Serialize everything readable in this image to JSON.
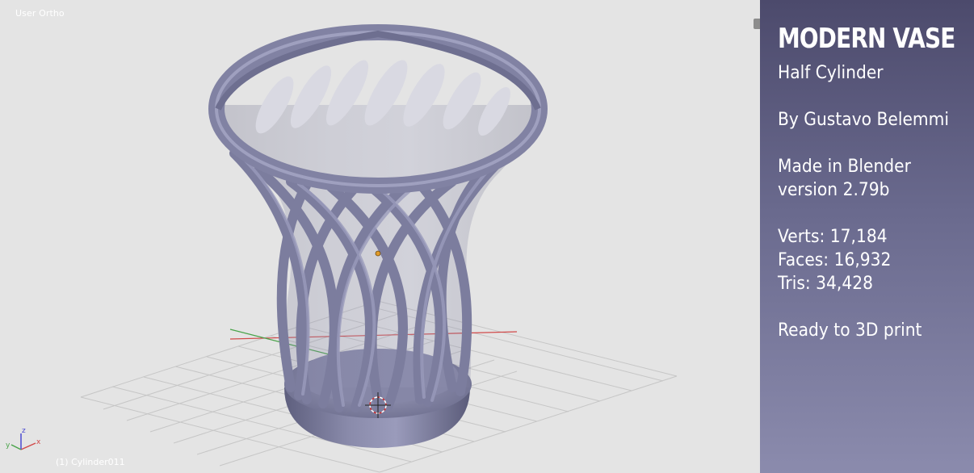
{
  "viewport": {
    "view_label": "User Ortho",
    "object_label": "(1) Cylinder011",
    "axis_labels": {
      "x": "x",
      "y": "y",
      "z": "z"
    },
    "colors": {
      "background": "#e4e4e4",
      "grid": "#c8c8c8",
      "x_axis": "#d14a4a",
      "y_axis": "#4aa34a",
      "mesh": "#7f80a1",
      "mesh_shadow": "#55566f"
    }
  },
  "panel": {
    "title": "MODERN VASE",
    "subtitle": "Half Cylinder",
    "author": "By Gustavo Belemmi",
    "made_in": "Made in Blender",
    "version": "version 2.79b",
    "verts": "Verts: 17,184",
    "faces": "Faces: 16,932",
    "tris": "Tris: 34,428",
    "ready": "Ready to 3D print"
  }
}
